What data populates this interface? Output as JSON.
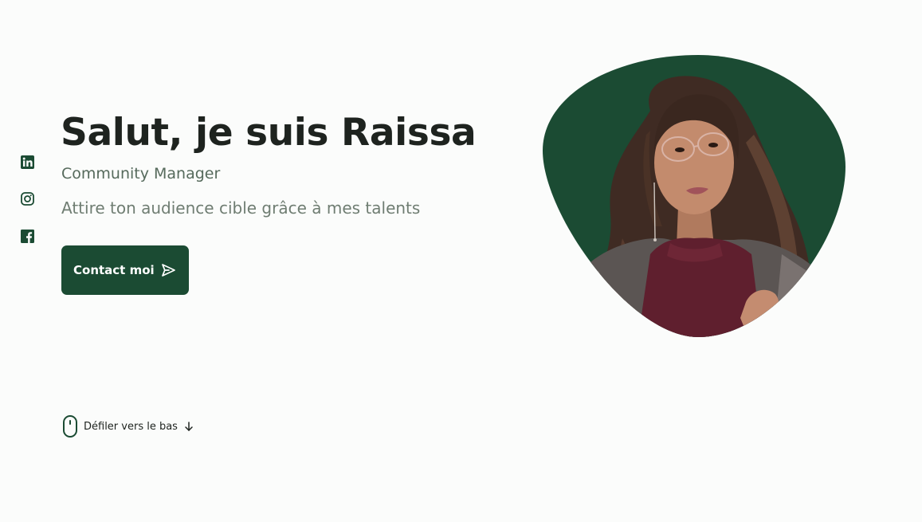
{
  "social": [
    {
      "name": "linkedin-icon"
    },
    {
      "name": "instagram-icon"
    },
    {
      "name": "facebook-icon"
    }
  ],
  "home": {
    "title": "Salut, je suis Raissa",
    "subtitle": "Community Manager",
    "description": "Attire ton audience cible grâce à mes talents",
    "contact_button_label": "Contact moi"
  },
  "scroll": {
    "label": "Défiler vers le bas"
  },
  "colors": {
    "accent": "#1b4b33",
    "background": "#fbfcfb",
    "title": "#1e231f",
    "subtitle": "#566a5c"
  }
}
